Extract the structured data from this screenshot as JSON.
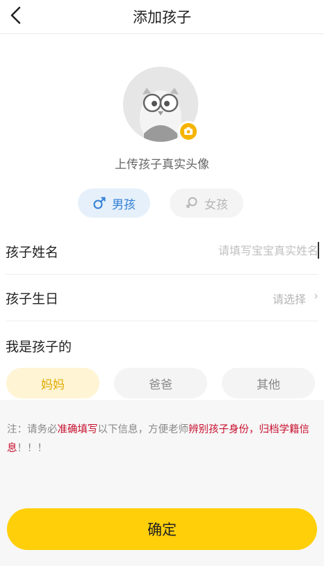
{
  "header": {
    "title": "添加孩子",
    "back_icon": "chevron-left-icon"
  },
  "avatar": {
    "upload_label": "上传孩子真实头像",
    "badge_icon": "camera-icon"
  },
  "gender": {
    "male": {
      "label": "男孩",
      "icon": "male-icon",
      "selected": true
    },
    "female": {
      "label": "女孩",
      "icon": "female-icon",
      "selected": false
    }
  },
  "form": {
    "name": {
      "label": "孩子姓名",
      "placeholder": "请填写宝宝真实姓名",
      "value": ""
    },
    "birthday": {
      "label": "孩子生日",
      "value": "请选择",
      "arrow": "›"
    }
  },
  "relation": {
    "title": "我是孩子的",
    "options": [
      {
        "label": "妈妈",
        "selected": true
      },
      {
        "label": "爸爸",
        "selected": false
      },
      {
        "label": "其他",
        "selected": false
      }
    ]
  },
  "note": {
    "parts": [
      "注：请务必",
      "准确填写",
      "以下信息，方便老师",
      "辨别孩子身份，归档学籍信息",
      "！！！"
    ]
  },
  "confirm_label": "确定",
  "colors": {
    "accent": "#ffcf0a",
    "male_blue": "#2f7fd6",
    "warning_red": "#c8102e"
  }
}
